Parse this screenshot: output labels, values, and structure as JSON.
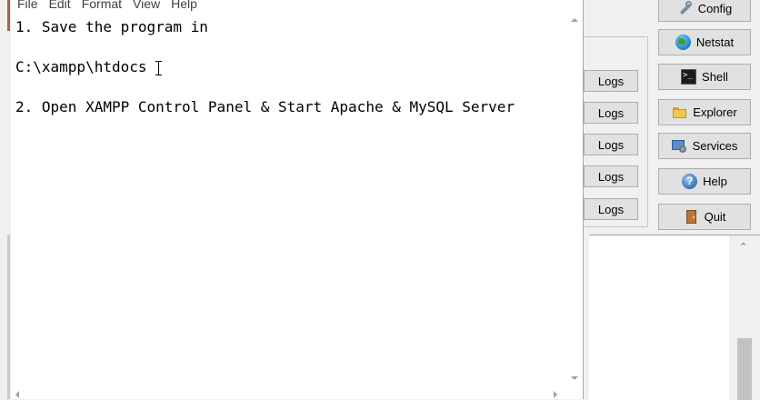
{
  "notepad": {
    "menu": [
      "File",
      "Edit",
      "Format",
      "View",
      "Help"
    ],
    "lines": [
      "1. Save the program in",
      "",
      "C:\\xampp\\htdocs",
      "",
      "2. Open XAMPP Control Panel & Start Apache & MySQL Server"
    ]
  },
  "xampp": {
    "logs_label": "Logs",
    "buttons": {
      "config": "Config",
      "netstat": "Netstat",
      "shell": "Shell",
      "explorer": "Explorer",
      "services": "Services",
      "help": "Help",
      "quit": "Quit"
    }
  },
  "icons": {
    "config": "wrench-icon",
    "netstat": "globe-icon",
    "shell": "terminal-icon",
    "explorer": "folder-icon",
    "services": "services-icon",
    "help": "help-icon",
    "quit": "exit-door-icon"
  },
  "colors": {
    "window_bg": "#f0f0f0",
    "button_bg": "#e1e1e1",
    "button_border": "#adadad",
    "editor_bg": "#ffffff"
  }
}
